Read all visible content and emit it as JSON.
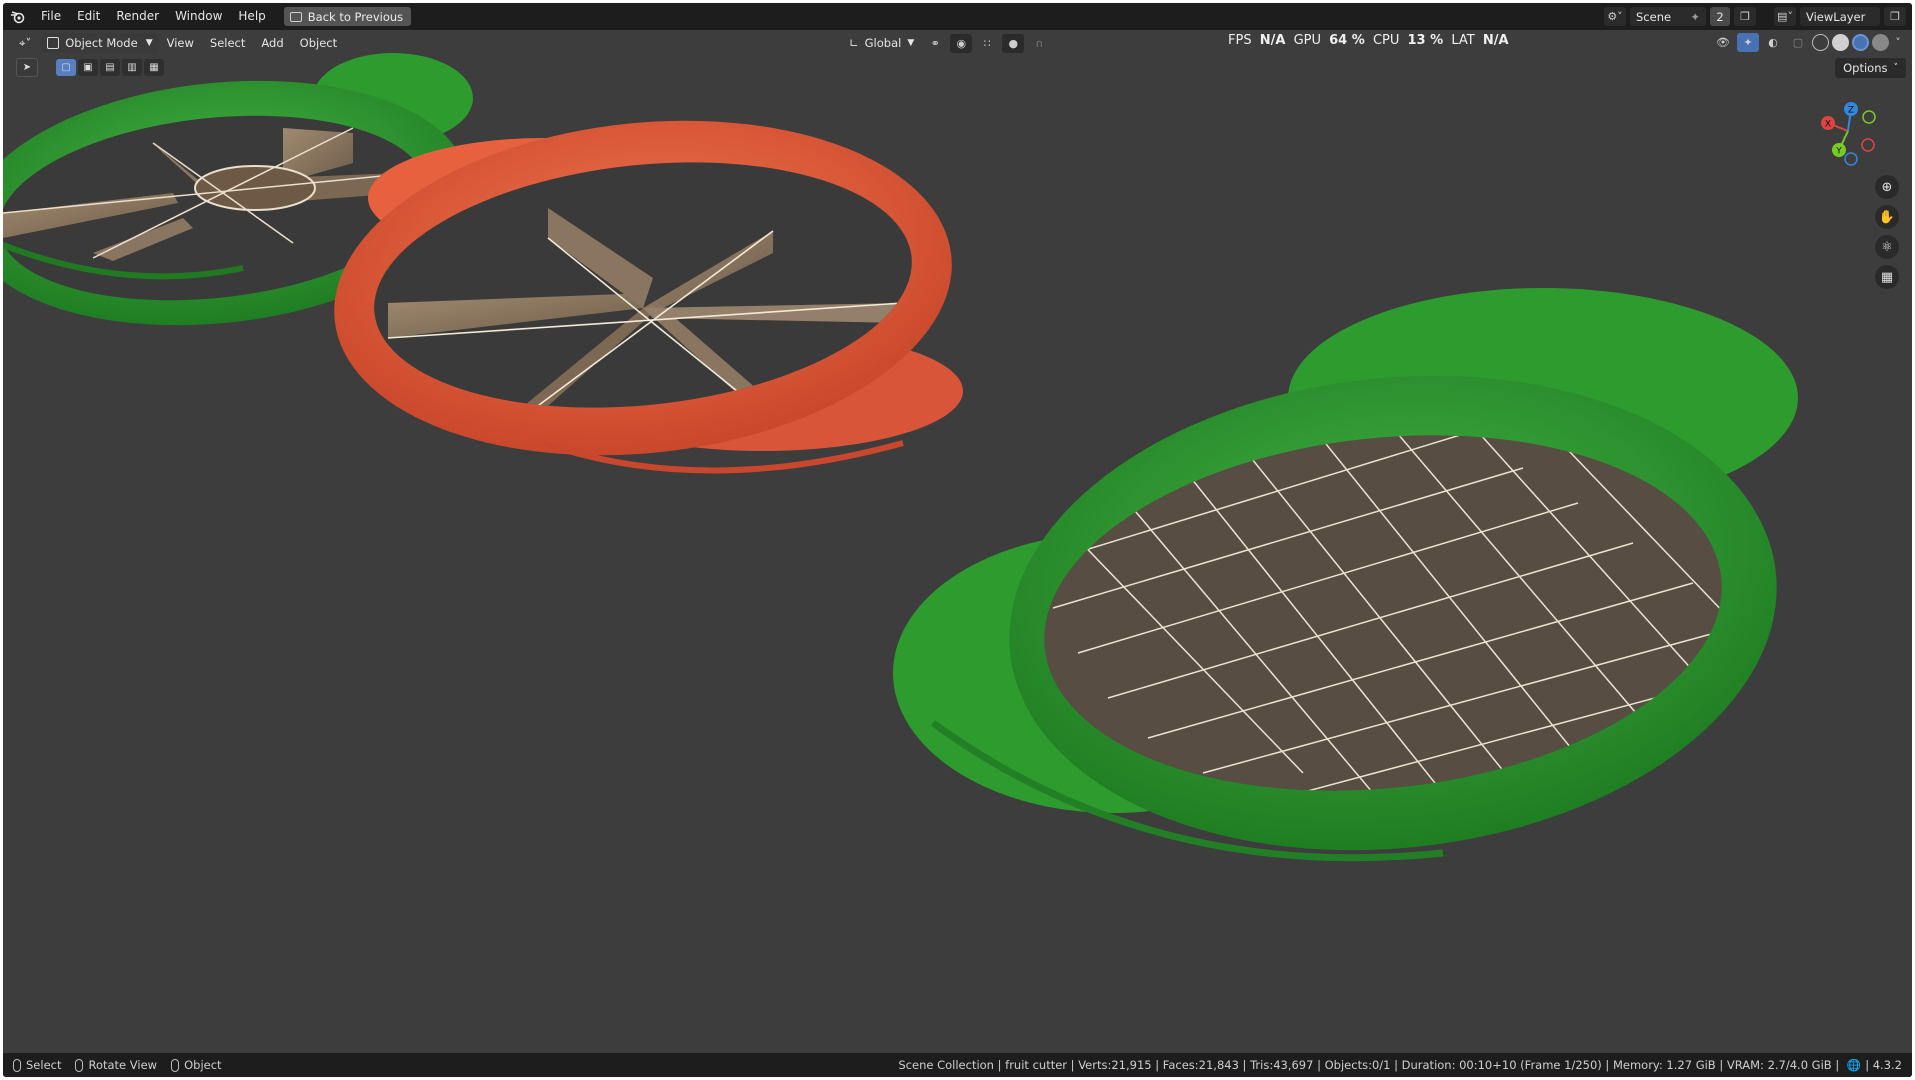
{
  "topbar": {
    "menus": [
      "File",
      "Edit",
      "Render",
      "Window",
      "Help"
    ],
    "back_button": "Back to Previous",
    "scene_name": "Scene",
    "scene_count": "2",
    "view_layer": "ViewLayer"
  },
  "header": {
    "mode": "Object Mode",
    "menus": [
      "View",
      "Select",
      "Add",
      "Object"
    ],
    "orientation": "Global",
    "stats": {
      "fps_label": "FPS",
      "fps_value": "N/A",
      "gpu_label": "GPU",
      "gpu_value": "64 %",
      "cpu_label": "CPU",
      "cpu_value": "13 %",
      "lat_label": "LAT",
      "lat_value": "N/A"
    },
    "options": "Options"
  },
  "gizmo": {
    "x": "X",
    "y": "Y",
    "z": "Z"
  },
  "statusbar": {
    "select": "Select",
    "rotate": "Rotate View",
    "object": "Object",
    "info": "Scene Collection | fruit cutter | Verts:21,915 | Faces:21,843 | Tris:43,697 | Objects:0/1 | Duration: 00:10+10 (Frame 1/250) | Memory: 1.27 GiB | VRAM: 2.7/4.0 GiB |",
    "version": "4.3.2"
  },
  "colors": {
    "viewport_bg": "#3d3d3d",
    "green_cutter": "#2e9b2e",
    "red_cutter": "#e8613f",
    "blade": "#8a7560"
  }
}
